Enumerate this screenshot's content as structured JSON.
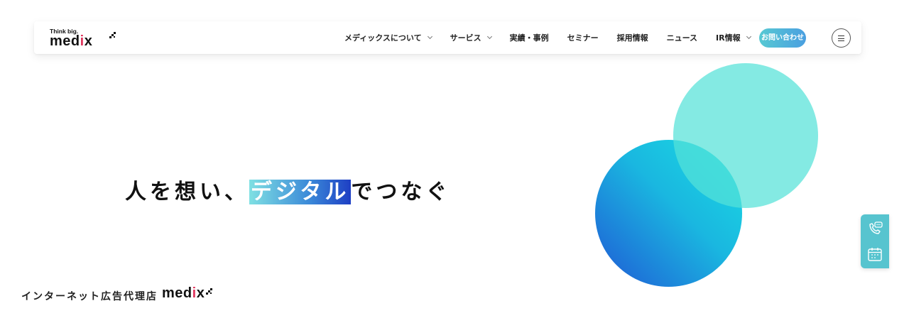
{
  "header": {
    "logo": {
      "tagline": "Think big.",
      "wordmark_pre": "med",
      "wordmark_i": "i",
      "wordmark_post": "x"
    },
    "nav": [
      {
        "label": "メディックスについて",
        "dropdown": true
      },
      {
        "label": "サービス",
        "dropdown": true
      },
      {
        "label": "実績・事例",
        "dropdown": false
      },
      {
        "label": "セミナー",
        "dropdown": false
      },
      {
        "label": "採用情報",
        "dropdown": false
      },
      {
        "label": "ニュース",
        "dropdown": false
      },
      {
        "label": "IR情報",
        "dropdown": true
      }
    ],
    "contact_label": "お問い合わせ",
    "menu_icon": "hamburger-icon"
  },
  "hero": {
    "copy_before": "人を想い、",
    "copy_highlight": "デジタル",
    "copy_after": "でつなぐ"
  },
  "footer_tag": {
    "text": "インターネット広告代理店",
    "logo_pre": "med",
    "logo_i": "i",
    "logo_post": "x"
  },
  "side_panel": {
    "icons": [
      "phone-chat-icon",
      "calendar-icon"
    ]
  },
  "colors": {
    "accent_pink": "#e0355c",
    "button_gradient_start": "#57c9d3",
    "button_gradient_end": "#4a9fe0",
    "mint_circle": "#54e2d8",
    "blue_circle_dark": "#1f58d5",
    "blue_circle_light": "#19dde3",
    "side_panel": "#57c4cf"
  }
}
